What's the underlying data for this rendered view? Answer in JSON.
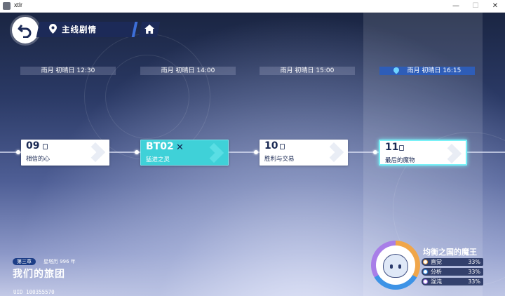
{
  "window": {
    "title": "xtlr",
    "minimize": "—",
    "maximize": "☐",
    "close": "✕"
  },
  "header": {
    "title": "主线剧情"
  },
  "timeline": [
    {
      "time": "雨月 初晴日 12:30",
      "active": false
    },
    {
      "time": "雨月 初晴日 14:00",
      "active": false
    },
    {
      "time": "雨月 初晴日 15:00",
      "active": false
    },
    {
      "time": "雨月 初晴日 16:15",
      "active": true
    }
  ],
  "stages": [
    {
      "num": "09",
      "name": "相信的心",
      "type": "story"
    },
    {
      "num": "BT02",
      "name": "猛进之灵",
      "type": "battle"
    },
    {
      "num": "10",
      "name": "胜利与交易",
      "type": "story"
    },
    {
      "num": "11",
      "name": "最后的魔物",
      "type": "story",
      "current": true
    }
  ],
  "chapter": {
    "badge": "第三章",
    "year": "星塔历 996 年",
    "title": "我们的旅团"
  },
  "uid": "UID 100355570",
  "boss": {
    "name": "均衡之国的魔王",
    "stats": [
      {
        "label": "直觉",
        "pct": "33%",
        "color": "#f0a64a"
      },
      {
        "label": "分析",
        "pct": "33%",
        "color": "#3d93e6"
      },
      {
        "label": "混沌",
        "pct": "33%",
        "color": "#a87ee8"
      }
    ]
  }
}
